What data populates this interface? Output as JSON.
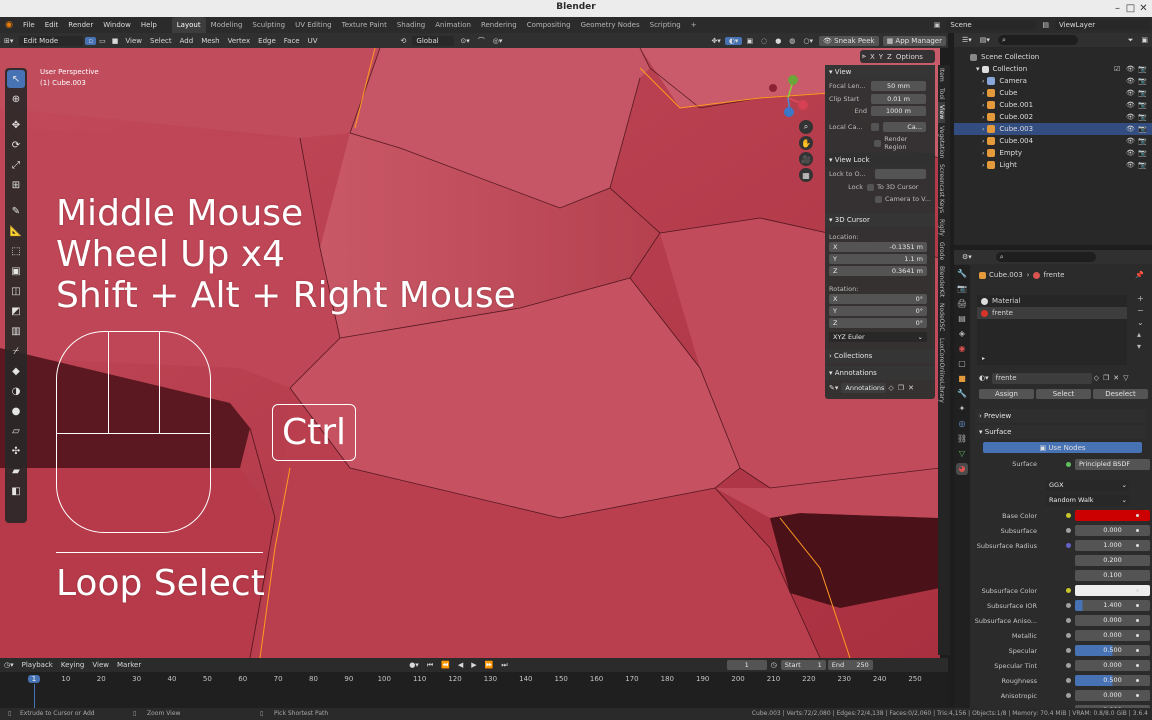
{
  "window": {
    "title": "Blender"
  },
  "menu": [
    "File",
    "Edit",
    "Render",
    "Window",
    "Help"
  ],
  "workspaces": [
    "Layout",
    "Modeling",
    "Sculpting",
    "UV Editing",
    "Texture Paint",
    "Shading",
    "Animation",
    "Rendering",
    "Compositing",
    "Geometry Nodes",
    "Scripting"
  ],
  "active_workspace": "Layout",
  "scene": {
    "scene": "Scene",
    "view_layer": "ViewLayer"
  },
  "viewport_header": {
    "mode": "Edit Mode",
    "menus": [
      "View",
      "Select",
      "Add",
      "Mesh",
      "Vertex",
      "Edge",
      "Face",
      "UV"
    ],
    "orientation": "Global",
    "sneak_peek": "Sneak Peek",
    "app_manager": "App Manager",
    "axes": [
      "X",
      "Y",
      "Z"
    ],
    "options": "Options"
  },
  "viewport": {
    "view_name": "User Perspective",
    "object_name": "(1) Cube.003"
  },
  "overlay": {
    "line1": "Middle Mouse",
    "line2": "Wheel Up x4",
    "line3": "Shift + Alt + Right Mouse",
    "key": "Ctrl",
    "action": "Loop Select"
  },
  "npanel": {
    "view_title": "View",
    "focal_label": "Focal Len...",
    "focal_value": "50 mm",
    "clip_start_label": "Clip Start",
    "clip_start_value": "0.01 m",
    "clip_end_label": "End",
    "clip_end_value": "1000 m",
    "local_camera_label": "Local Ca...",
    "local_camera_value": "Ca...",
    "render_region": "Render Region",
    "view_lock_title": "View Lock",
    "lock_to_label": "Lock to O...",
    "lock_label": "Lock",
    "to_3d_cursor": "To 3D Cursor",
    "camera_to_view": "Camera to V...",
    "cursor_title": "3D Cursor",
    "location_label": "Location:",
    "loc_x_label": "X",
    "loc_x": "-0.1351 m",
    "loc_y_label": "Y",
    "loc_y": "1.1 m",
    "loc_z_label": "Z",
    "loc_z": "0.3641 m",
    "rotation_label": "Rotation:",
    "rot_x_label": "X",
    "rot_x": "0°",
    "rot_y_label": "Y",
    "rot_y": "0°",
    "rot_z_label": "Z",
    "rot_z": "0°",
    "rotation_mode": "XYZ Euler",
    "collections_title": "Collections",
    "annotations_title": "Annotations",
    "annotations_value": "Annotations"
  },
  "vertical_tabs": [
    "Item",
    "Tool",
    "View",
    "Vegetation",
    "Screencast Keys",
    "Rigify",
    "Grode",
    "BlenderKit",
    "NodeOSC",
    "LuxCoreOnlineLibrary"
  ],
  "outliner": {
    "scene_collection": "Scene Collection",
    "collection": "Collection",
    "items": [
      {
        "name": "Camera",
        "color": "#8aa7d9"
      },
      {
        "name": "Cube",
        "color": "#e59b3c"
      },
      {
        "name": "Cube.001",
        "color": "#e59b3c"
      },
      {
        "name": "Cube.002",
        "color": "#e59b3c"
      },
      {
        "name": "Cube.003",
        "color": "#e59b3c",
        "selected": true
      },
      {
        "name": "Cube.004",
        "color": "#e59b3c"
      },
      {
        "name": "Empty",
        "color": "#e59b3c"
      },
      {
        "name": "Light",
        "color": "#e59b3c"
      }
    ]
  },
  "properties": {
    "breadcrumb_object": "Cube.003",
    "breadcrumb_material": "frente",
    "slots": [
      "Material",
      "frente"
    ],
    "material_name": "frente",
    "assign": "Assign",
    "select": "Select",
    "deselect": "Deselect",
    "preview": "Preview",
    "surface_panel": "Surface",
    "use_nodes": "Use Nodes",
    "surface_label": "Surface",
    "surface_value": "Principled BSDF",
    "distribution": "GGX",
    "subsurface_method": "Random Walk",
    "rows": [
      {
        "label": "Base Color",
        "value": "",
        "type": "color",
        "color": "#cc0000"
      },
      {
        "label": "Subsurface",
        "value": "0.000"
      },
      {
        "label": "Subsurface Radius",
        "value": "1.000",
        "type": "vector"
      },
      {
        "label": "",
        "value": "0.200",
        "type": "vector"
      },
      {
        "label": "",
        "value": "0.100",
        "type": "vector"
      },
      {
        "label": "Subsurface Color",
        "value": "",
        "type": "color",
        "color": "#eeeeee"
      },
      {
        "label": "Subsurface IOR",
        "value": "1.400",
        "fill": 0.1
      },
      {
        "label": "Subsurface Aniso...",
        "value": "0.000"
      },
      {
        "label": "Metallic",
        "value": "0.000"
      },
      {
        "label": "Specular",
        "value": "0.500",
        "fill": 0.5
      },
      {
        "label": "Specular Tint",
        "value": "0.000"
      },
      {
        "label": "Roughness",
        "value": "0.500",
        "fill": 0.5
      },
      {
        "label": "Anisotropic",
        "value": "0.000"
      },
      {
        "label": "Anisotropic Rota...",
        "value": "0.000"
      }
    ]
  },
  "timeline": {
    "menus": [
      "Playback",
      "Keying",
      "View",
      "Marker"
    ],
    "current_frame": "1",
    "start_label": "Start",
    "start": "1",
    "end_label": "End",
    "end": "250",
    "ticks": [
      "1",
      "10",
      "20",
      "30",
      "40",
      "50",
      "60",
      "70",
      "80",
      "90",
      "100",
      "110",
      "120",
      "130",
      "140",
      "150",
      "160",
      "170",
      "180",
      "190",
      "200",
      "210",
      "220",
      "230",
      "240",
      "250"
    ]
  },
  "statusbar": {
    "left": "Extrude to Cursor or Add",
    "middle": "Zoom View",
    "right_action": "Pick Shortest Path",
    "stats": "Cube.003 | Verts:72/2,080 | Edges:72/4,138 | Faces:0/2,060 | Tris:4,156 | Objects:1/8 | Memory: 70.4 MiB | VRAM: 0.8/8.0 GiB | 3.6.4"
  },
  "colors": {
    "accent": "#4772b3",
    "viewport_face": "#b13c4b",
    "edge_highlight": "#ff9a1f"
  }
}
